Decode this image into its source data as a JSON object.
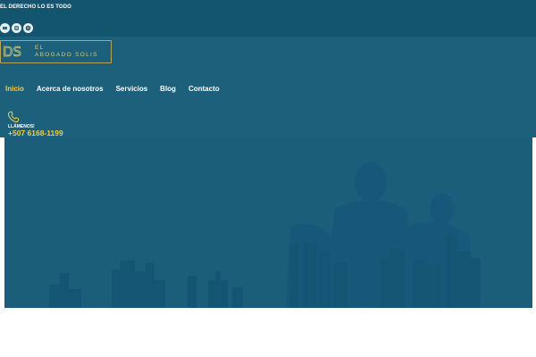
{
  "topbar": {
    "tagline": "EL DERECHO LO ES TODO",
    "socials": [
      {
        "icon": "youtube-icon"
      },
      {
        "icon": "instagram-icon"
      },
      {
        "icon": "spotify-icon"
      }
    ]
  },
  "logo": {
    "mark": "DS",
    "line1": "EL",
    "line2": "ABOGADO SOLIS"
  },
  "nav": {
    "items": [
      {
        "label": "Inicio",
        "active": true
      },
      {
        "label": "Acerca de nosotros"
      },
      {
        "label": "Servicios"
      },
      {
        "label": "Blog"
      },
      {
        "label": "Contacto"
      }
    ]
  },
  "call": {
    "icon": "phone-icon",
    "label": "LLÁMENOS!",
    "number": "+507 6168-1199"
  },
  "colors": {
    "topbar": "#13556f",
    "header": "#1c607b",
    "accent": "#f2cd3c",
    "logo_gold": "#d9c774"
  }
}
